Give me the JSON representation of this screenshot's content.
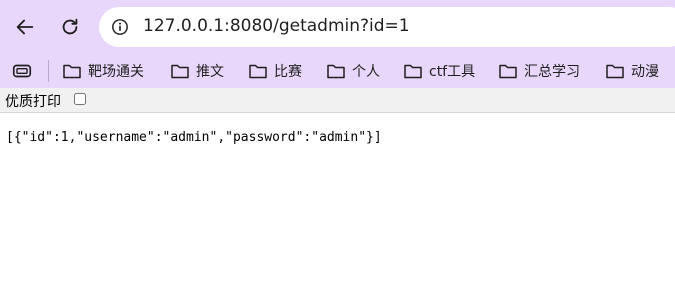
{
  "browser": {
    "url": "127.0.0.1:8080/getadmin?id=1",
    "back_icon": "arrow-left-icon",
    "reload_icon": "reload-icon",
    "site_info_icon": "info-icon"
  },
  "bookmarks": {
    "apps_icon": "tab-group-icon",
    "items": [
      {
        "label": "靶场通关",
        "icon": "folder-icon"
      },
      {
        "label": "推文",
        "icon": "folder-icon"
      },
      {
        "label": "比赛",
        "icon": "folder-icon"
      },
      {
        "label": "个人",
        "icon": "folder-icon"
      },
      {
        "label": "ctf工具",
        "icon": "folder-icon"
      },
      {
        "label": "汇总学习",
        "icon": "folder-icon"
      },
      {
        "label": "动漫",
        "icon": "folder-icon"
      }
    ]
  },
  "print_bar": {
    "label": "优质打印",
    "checked": false
  },
  "page": {
    "body_text": "[{\"id\":1,\"username\":\"admin\",\"password\":\"admin\"}]"
  },
  "colors": {
    "toolbar_bg": "#e8d7fb",
    "omnibox_bg": "#ffffff",
    "print_bar_bg": "#f1f1f1"
  }
}
